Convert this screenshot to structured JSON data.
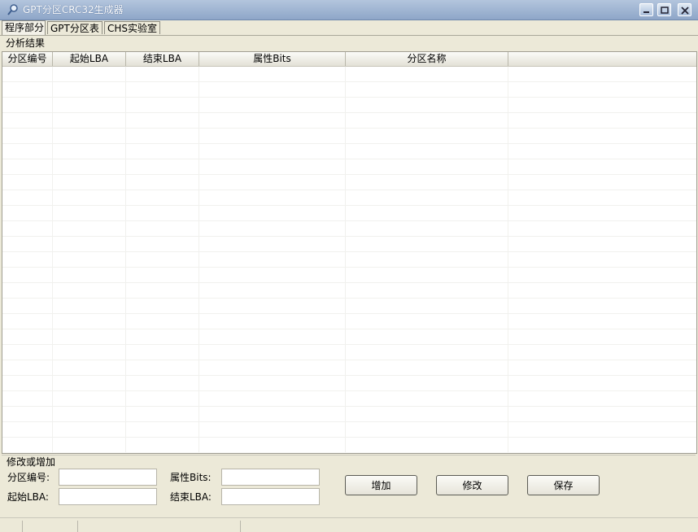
{
  "window": {
    "title": "GPT分区CRC32生成器"
  },
  "tabs": [
    {
      "label": "程序部分",
      "active": true
    },
    {
      "label": "GPT分区表",
      "active": false
    },
    {
      "label": "CHS实验室",
      "active": false
    }
  ],
  "results": {
    "group_title": "分析结果",
    "columns": [
      "分区编号",
      "起始LBA",
      "结束LBA",
      "属性Bits",
      "分区名称"
    ],
    "rows": []
  },
  "edit": {
    "group_title": "修改或增加",
    "fields": {
      "partition_no": {
        "label": "分区编号:",
        "value": ""
      },
      "start_lba": {
        "label": "起始LBA:",
        "value": ""
      },
      "attr_bits": {
        "label": "属性Bits:",
        "value": ""
      },
      "end_lba": {
        "label": "结束LBA:",
        "value": ""
      }
    },
    "buttons": {
      "add": "增加",
      "modify": "修改",
      "save": "保存"
    }
  },
  "icons": {
    "app": "magnifier-icon",
    "minimize": "minimize-icon",
    "maximize": "maximize-icon",
    "close": "close-icon"
  },
  "colors": {
    "titlebar": "#9fb4d3",
    "window_bg": "#ece9d8"
  }
}
